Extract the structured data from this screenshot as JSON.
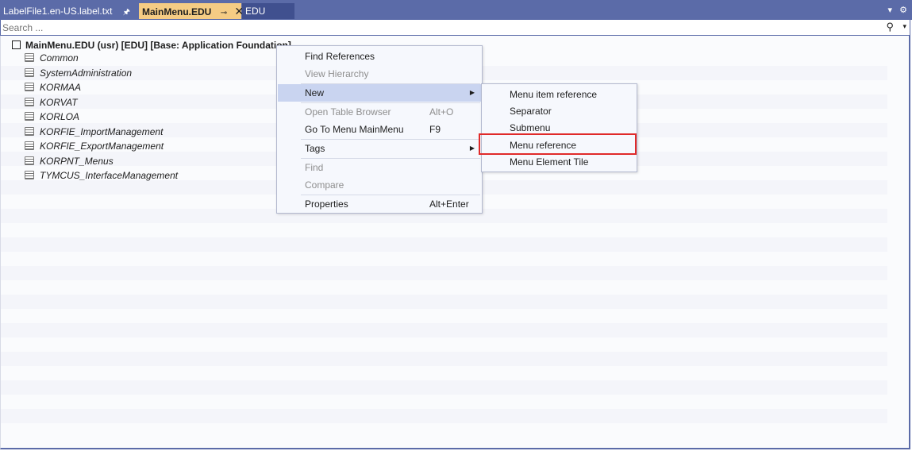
{
  "tabs": {
    "file": "LabelFile1.en-US.label.txt",
    "active": "MainMenu.EDU",
    "third": "EDU",
    "pin": "ꟷ",
    "active_pin": "⊸",
    "close": "✕"
  },
  "search": {
    "placeholder": "Search ..."
  },
  "tree": {
    "root": "MainMenu.EDU (usr) [EDU] [Base: Application Foundation]",
    "nodes": [
      "Common",
      "SystemAdministration",
      "KORMAA",
      "KORVAT",
      "KORLOA",
      "KORFIE_ImportManagement",
      "KORFIE_ExportManagement",
      "KORPNT_Menus",
      "TYMCUS_InterfaceManagement"
    ]
  },
  "context_menu": {
    "find_references": "Find References",
    "view_hierarchy": "View Hierarchy",
    "new": "New",
    "open_table_browser": "Open Table Browser",
    "open_table_browser_shortcut": "Alt+O",
    "go_to_menu": "Go To Menu MainMenu",
    "go_to_menu_shortcut": "F9",
    "tags": "Tags",
    "find": "Find",
    "compare": "Compare",
    "properties": "Properties",
    "properties_shortcut": "Alt+Enter"
  },
  "new_submenu": {
    "menu_item_reference": "Menu item reference",
    "separator": "Separator",
    "submenu": "Submenu",
    "menu_reference": "Menu reference",
    "menu_element_tile": "Menu Element Tile"
  },
  "icons": {
    "tab_dropdown": "chevron-down-icon",
    "settings": "gear-icon",
    "search": "search-icon",
    "submenu_arrow": "chevron-right-icon"
  },
  "colors": {
    "tab_bar": "#5b6ba8",
    "active_tab": "#f5cc84",
    "menu_highlight": "#c9d4f0",
    "callout": "#e02a2a"
  }
}
